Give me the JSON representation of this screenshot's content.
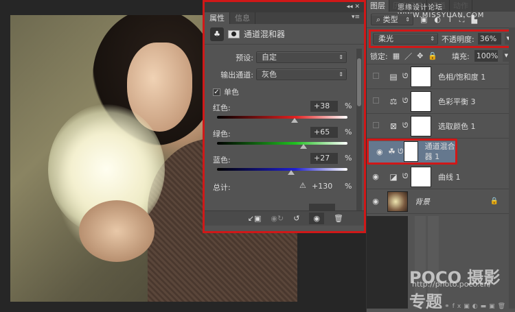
{
  "properties": {
    "tabs": [
      "属性",
      "信息"
    ],
    "title": "通道混和器",
    "preset_label": "预设:",
    "preset_value": "自定",
    "output_label": "输出通道:",
    "output_value": "灰色",
    "monochrome_label": "单色",
    "monochrome_checked": true,
    "channels": [
      {
        "name": "红色:",
        "value": "+38",
        "pct": "%",
        "percent": 38,
        "color": "#e02020"
      },
      {
        "name": "绿色:",
        "value": "+65",
        "pct": "%",
        "percent": 65,
        "color": "#20c020"
      },
      {
        "name": "蓝色:",
        "value": "+27",
        "pct": "%",
        "percent": 27,
        "color": "#2020d0"
      }
    ],
    "total_label": "总计:",
    "total_value": "+130",
    "total_pct": "%"
  },
  "layers_panel": {
    "tabs": [
      "图层",
      "历史记录",
      "通道",
      "动作"
    ],
    "filter_type": "类型",
    "blend_mode": "柔光",
    "opacity_label": "不透明度:",
    "opacity_value": "36%",
    "lock_label": "锁定:",
    "fill_label": "填充:",
    "fill_value": "100%",
    "layers": [
      {
        "name": "色相/饱和度 1",
        "visible": false,
        "icon": "hue-saturation-icon",
        "glyph": "▤"
      },
      {
        "name": "色彩平衡 3",
        "visible": false,
        "icon": "color-balance-icon",
        "glyph": "⚖"
      },
      {
        "name": "选取颜色 1",
        "visible": false,
        "icon": "selective-color-icon",
        "glyph": "⊠"
      },
      {
        "name": "通道混合器 1",
        "visible": true,
        "icon": "channel-mixer-icon",
        "glyph": "☘",
        "selected": true
      },
      {
        "name": "曲线 1",
        "visible": true,
        "icon": "curves-icon",
        "glyph": "◪"
      },
      {
        "name": "背景",
        "visible": true,
        "icon": "background-thumbnail",
        "locked": true
      }
    ]
  },
  "watermarks": {
    "forum": "思缘设计论坛 WWW.MISSYUAN.COM",
    "poco": "POCO 摄影专题",
    "url": "http://photo.poco.cn/"
  }
}
